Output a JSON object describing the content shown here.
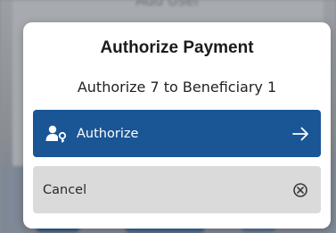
{
  "background": {
    "top_text": "Add User"
  },
  "dialog": {
    "title": "Authorize Payment",
    "message": "Authorize 7 to Beneficiary 1",
    "authorize_button": {
      "label": "Authorize",
      "left_icon": "user-key-icon",
      "right_icon": "arrow-right-icon"
    },
    "cancel_button": {
      "label": "Cancel",
      "right_icon": "close-circle-icon"
    }
  },
  "colors": {
    "primary": "#1a5596",
    "secondary": "#dadada",
    "dialog_bg": "#ffffff"
  }
}
